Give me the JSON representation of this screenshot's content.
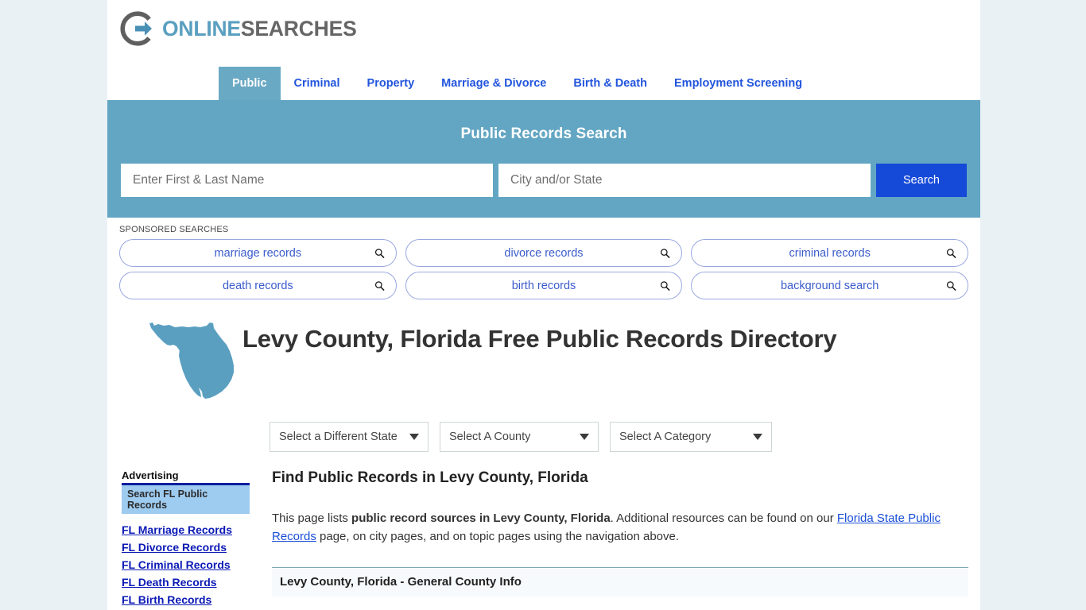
{
  "site": {
    "logo_primary": "ONLINE",
    "logo_secondary": "SEARCHES",
    "logo_icon": "circle-arrow-logo-icon",
    "colors": {
      "brand_blue": "#5a9fc0",
      "brand_gray": "#666666",
      "banner": "#63a6c3",
      "search_button": "#1549d8",
      "link_blue": "#2255dd",
      "page_bg": "#eaf1f5",
      "ad_box": "#9ecbf0",
      "ad_rule": "#0b1fa0"
    }
  },
  "nav": {
    "items": [
      {
        "label": "Public",
        "active": true
      },
      {
        "label": "Criminal",
        "active": false
      },
      {
        "label": "Property",
        "active": false
      },
      {
        "label": "Marriage & Divorce",
        "active": false
      },
      {
        "label": "Birth & Death",
        "active": false
      },
      {
        "label": "Employment Screening",
        "active": false
      }
    ]
  },
  "search_banner": {
    "title": "Public Records Search",
    "name_placeholder": "Enter First & Last Name",
    "name_value": "",
    "city_placeholder": "City and/or State",
    "city_value": "",
    "button_label": "Search"
  },
  "sponsored": {
    "label": "SPONSORED SEARCHES",
    "icon": "magnifier-icon",
    "items": [
      {
        "label": "marriage records"
      },
      {
        "label": "divorce records"
      },
      {
        "label": "criminal records"
      },
      {
        "label": "death records"
      },
      {
        "label": "birth records"
      },
      {
        "label": "background search"
      }
    ]
  },
  "hero": {
    "map_icon": "florida-state-map-icon",
    "title": "Levy County, Florida Free Public Records Directory"
  },
  "selectors": [
    {
      "name": "state",
      "value": "Select a Different State"
    },
    {
      "name": "county",
      "value": "Select A County"
    },
    {
      "name": "category",
      "value": "Select A Category"
    }
  ],
  "sidebar": {
    "heading": "Advertising",
    "promo_label": "Search FL Public Records",
    "links": [
      {
        "label": "FL Marriage Records"
      },
      {
        "label": "FL Divorce Records"
      },
      {
        "label": "FL Criminal Records"
      },
      {
        "label": "FL Death Records"
      },
      {
        "label": "FL Birth Records"
      }
    ]
  },
  "main": {
    "heading": "Find Public Records in Levy County, Florida",
    "intro_1": "This page lists ",
    "intro_bold": "public record sources in Levy County, Florida",
    "intro_2": ". Additional resources can be found on our ",
    "intro_link": "Florida State Public Records",
    "intro_3": " page, on city pages, and on topic pages using the navigation above.",
    "table_header": "Levy County, Florida - General County Info"
  }
}
